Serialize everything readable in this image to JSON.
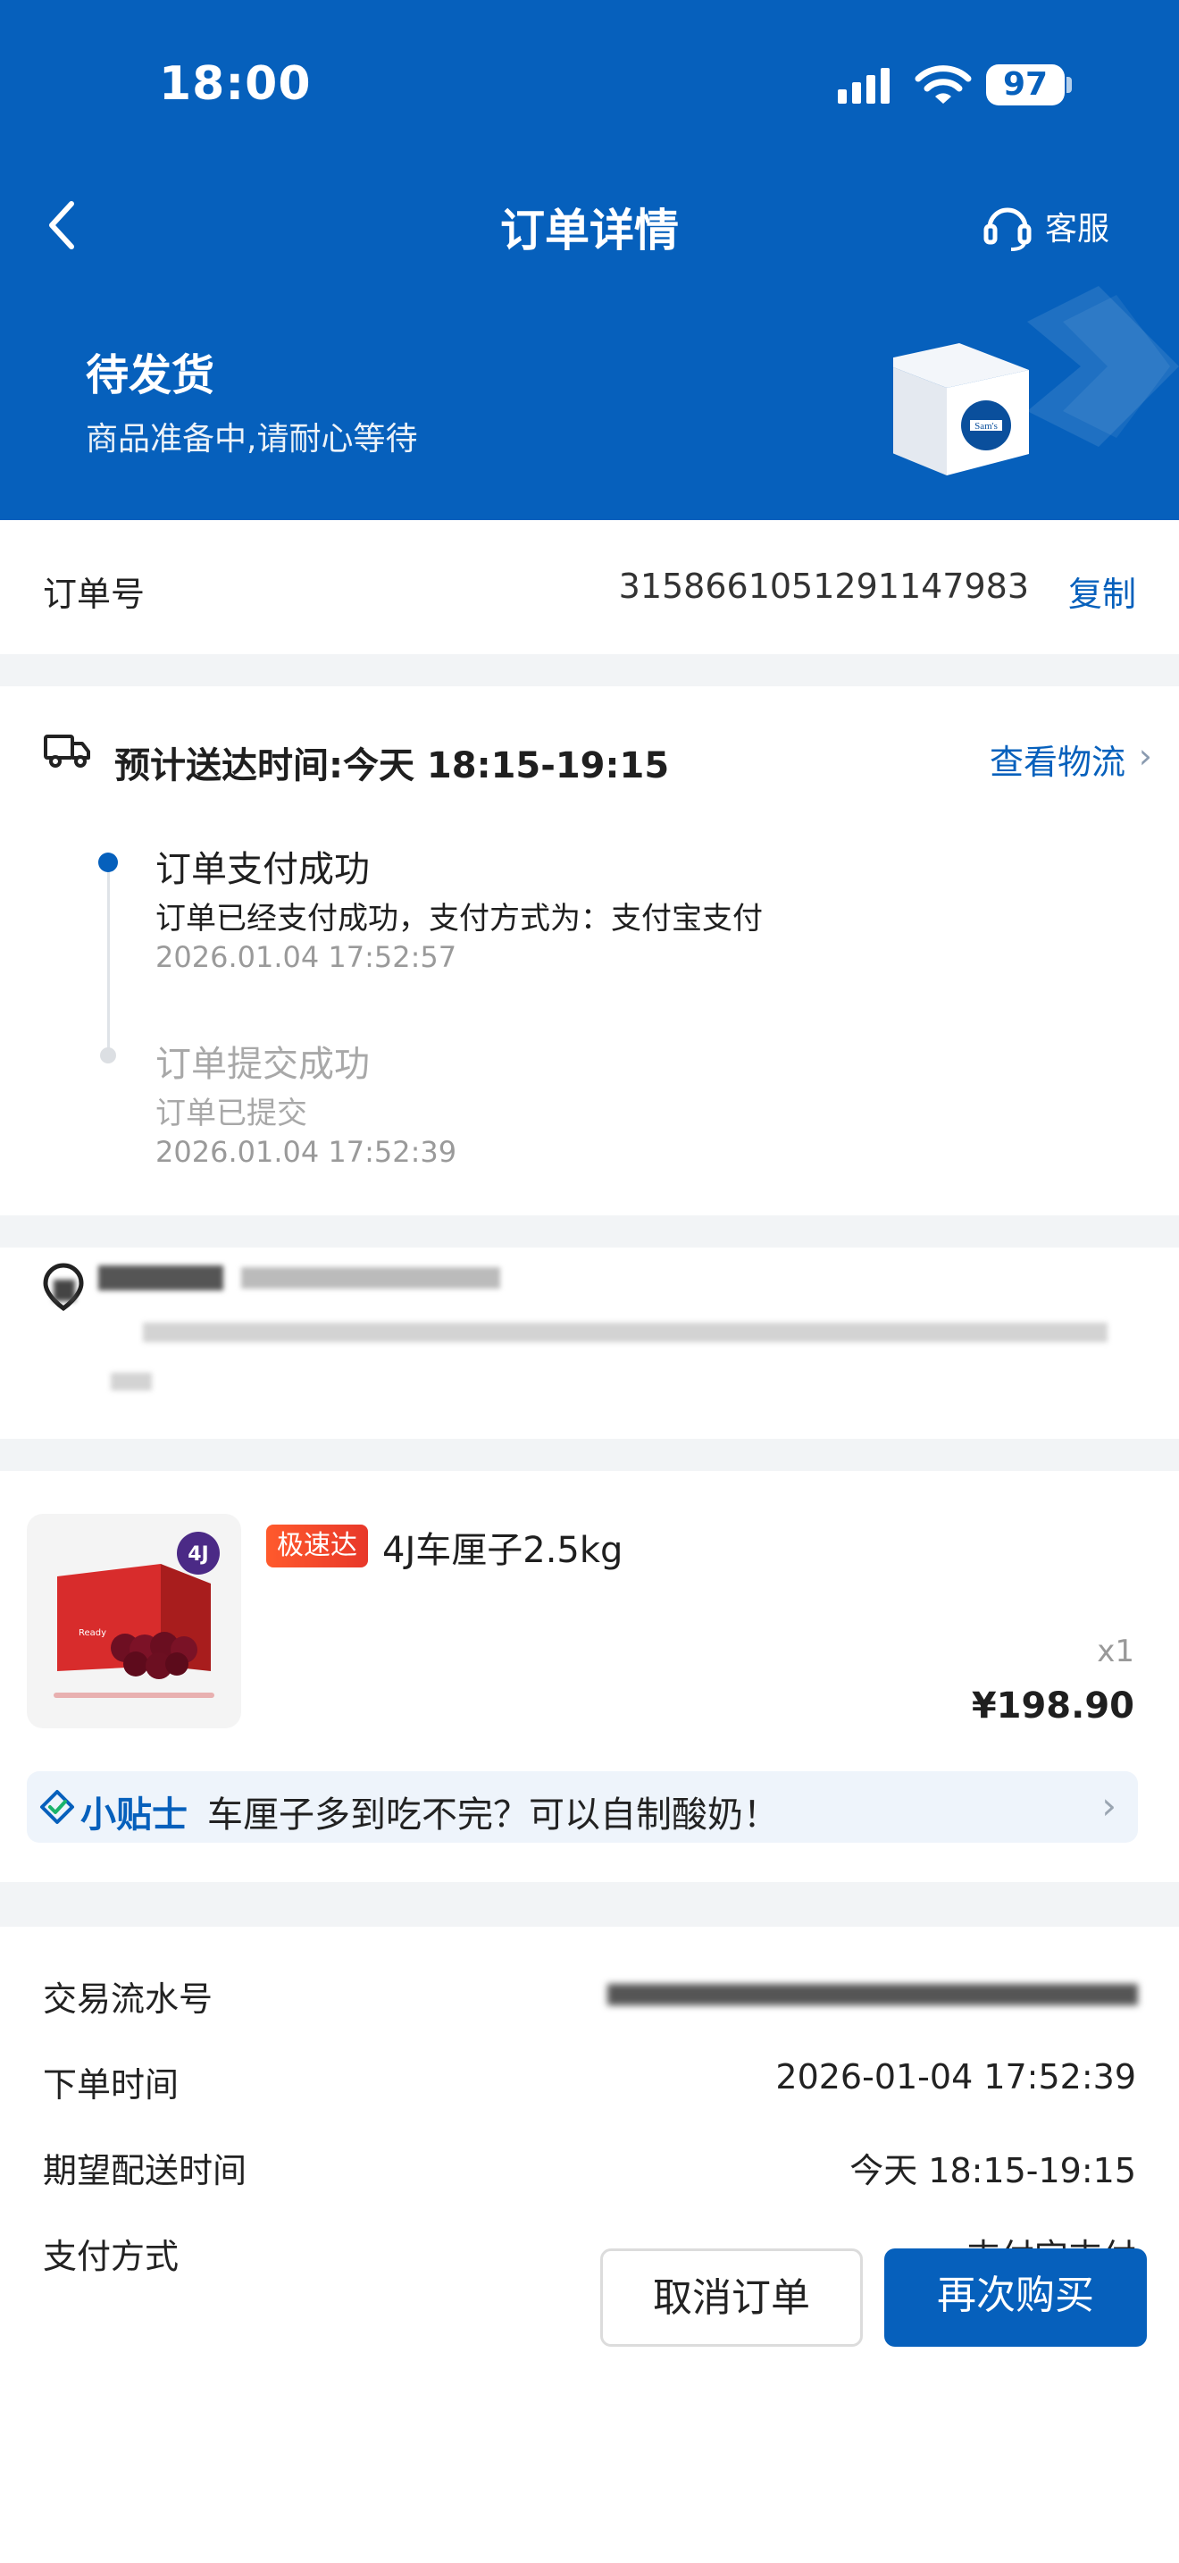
{
  "status_bar": {
    "time": "18:00",
    "battery": "97"
  },
  "nav": {
    "title": "订单详情",
    "customer_service": "客服"
  },
  "order_status": {
    "title": "待发货",
    "subtitle": "商品准备中,请耐心等待",
    "box_brand": "Sam's"
  },
  "order_no": {
    "label": "订单号",
    "value": "3158661051291147983",
    "copy": "复制"
  },
  "logistics": {
    "eta": "预计送达时间:今天 18:15-19:15",
    "track_link": "查看物流",
    "events": [
      {
        "title": "订单支付成功",
        "desc": "订单已经支付成功，支付方式为：支付宝支付",
        "time": "2026.01.04 17:52:57"
      },
      {
        "title": "订单提交成功",
        "desc": "订单已提交",
        "time": "2026.01.04 17:52:39"
      }
    ]
  },
  "product": {
    "tag": "极速达",
    "name": "4J车厘子2.5kg",
    "qty": "x1",
    "price": "¥198.90",
    "thumb_badge": "4J"
  },
  "tip": {
    "label": "小贴士",
    "text": "车厘子多到吃不完？可以自制酸奶！"
  },
  "info": [
    {
      "label": "交易流水号",
      "value": ""
    },
    {
      "label": "下单时间",
      "value": "2026-01-04 17:52:39"
    },
    {
      "label": "期望配送时间",
      "value": "今天 18:15-19:15"
    },
    {
      "label": "支付方式",
      "value": "支付宝支付"
    }
  ],
  "actions": {
    "cancel": "取消订单",
    "rebuy": "再次购买"
  },
  "colors": {
    "brand_blue": "#0660bc",
    "tag_red": "#e8382a",
    "page_bg": "#f2f4f6"
  }
}
